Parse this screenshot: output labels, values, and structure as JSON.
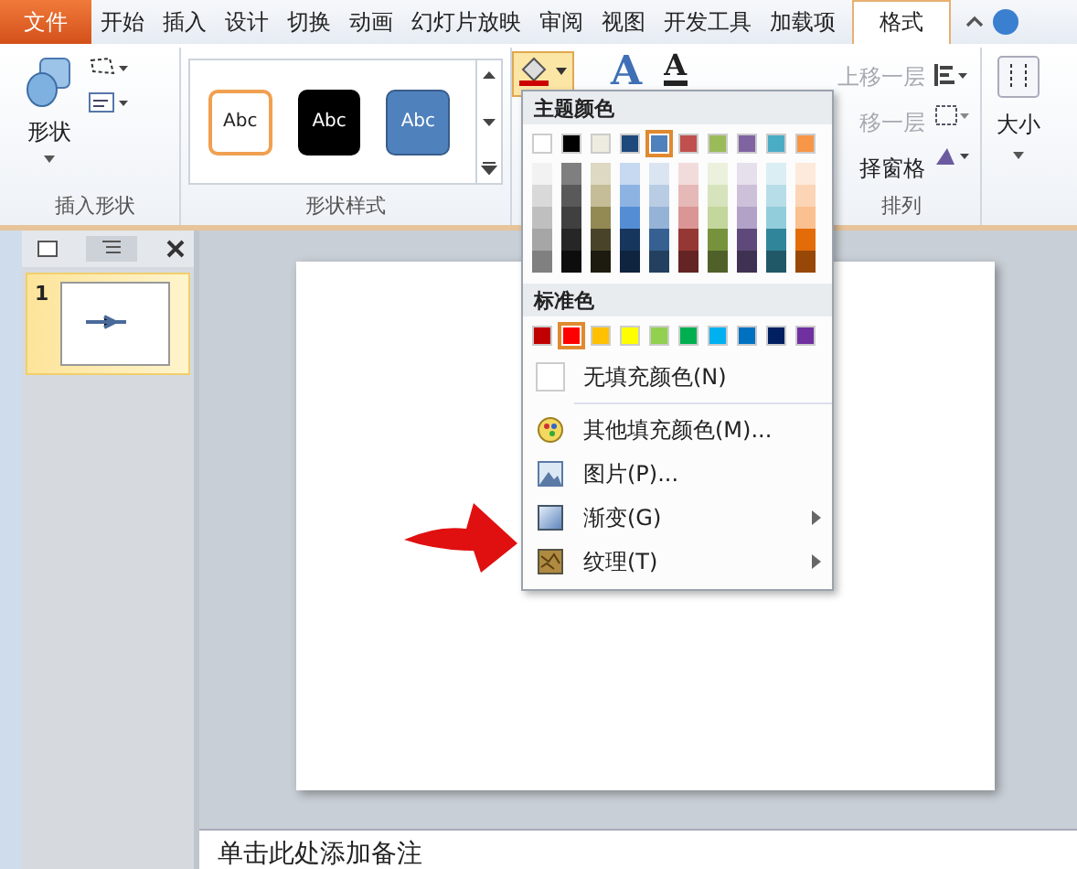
{
  "tabs": [
    {
      "label": "文件",
      "kind": "file",
      "selected": false
    },
    {
      "label": "开始",
      "kind": "tab",
      "selected": false
    },
    {
      "label": "插入",
      "kind": "tab",
      "selected": false
    },
    {
      "label": "设计",
      "kind": "tab",
      "selected": false
    },
    {
      "label": "切换",
      "kind": "tab",
      "selected": false
    },
    {
      "label": "动画",
      "kind": "tab",
      "selected": false
    },
    {
      "label": "幻灯片放映",
      "kind": "tab",
      "selected": false
    },
    {
      "label": "审阅",
      "kind": "tab",
      "selected": false
    },
    {
      "label": "视图",
      "kind": "tab",
      "selected": false
    },
    {
      "label": "开发工具",
      "kind": "tab",
      "selected": false
    },
    {
      "label": "加载项",
      "kind": "tab",
      "selected": false
    },
    {
      "label": "格式",
      "kind": "tab",
      "selected": true
    }
  ],
  "ribbon": {
    "insert_shapes": {
      "shapes_button": "形状",
      "group_label": "插入形状"
    },
    "shape_styles": {
      "styles": [
        {
          "label": "Abc",
          "kind": "outline"
        },
        {
          "label": "Abc",
          "kind": "black"
        },
        {
          "label": "Abc",
          "kind": "blue"
        }
      ],
      "group_label": "形状样式"
    },
    "wordart": {
      "quick_styles": "A",
      "text_fill": "A"
    },
    "arrange": {
      "items": [
        {
          "label": "上移一层",
          "disabled": true
        },
        {
          "label": "移一层",
          "disabled": true
        },
        {
          "label": "择窗格",
          "disabled": false
        }
      ],
      "group_label": "排列"
    },
    "size": {
      "button": "大小"
    }
  },
  "fill_menu": {
    "theme_header": "主题颜色",
    "theme_colors": [
      {
        "color": "#ffffff",
        "selected": false,
        "shades": [
          {
            "color": "#f2f2f2"
          },
          {
            "color": "#d9d9d9"
          },
          {
            "color": "#bfbfbf"
          },
          {
            "color": "#a6a6a6"
          },
          {
            "color": "#808080"
          }
        ]
      },
      {
        "color": "#000000",
        "selected": false,
        "shades": [
          {
            "color": "#7f7f7f"
          },
          {
            "color": "#595959"
          },
          {
            "color": "#404040"
          },
          {
            "color": "#262626"
          },
          {
            "color": "#0d0d0d"
          }
        ]
      },
      {
        "color": "#eeece1",
        "selected": false,
        "shades": [
          {
            "color": "#ddd9c3"
          },
          {
            "color": "#c4bd97"
          },
          {
            "color": "#938953"
          },
          {
            "color": "#494429"
          },
          {
            "color": "#1d1b10"
          }
        ]
      },
      {
        "color": "#1f497d",
        "selected": false,
        "shades": [
          {
            "color": "#c6d9f0"
          },
          {
            "color": "#8db3e2"
          },
          {
            "color": "#548dd4"
          },
          {
            "color": "#17365d"
          },
          {
            "color": "#0f243e"
          }
        ]
      },
      {
        "color": "#4f81bd",
        "selected": true,
        "shades": [
          {
            "color": "#dbe5f1"
          },
          {
            "color": "#b8cce4"
          },
          {
            "color": "#95b3d7"
          },
          {
            "color": "#366092"
          },
          {
            "color": "#244061"
          }
        ]
      },
      {
        "color": "#c0504d",
        "selected": false,
        "shades": [
          {
            "color": "#f2dcdb"
          },
          {
            "color": "#e5b9b7"
          },
          {
            "color": "#d99694"
          },
          {
            "color": "#953734"
          },
          {
            "color": "#632423"
          }
        ]
      },
      {
        "color": "#9bbb59",
        "selected": false,
        "shades": [
          {
            "color": "#ebf1dd"
          },
          {
            "color": "#d7e3bc"
          },
          {
            "color": "#c3d69b"
          },
          {
            "color": "#76923c"
          },
          {
            "color": "#4f6128"
          }
        ]
      },
      {
        "color": "#8064a2",
        "selected": false,
        "shades": [
          {
            "color": "#e5e0ec"
          },
          {
            "color": "#ccc1d9"
          },
          {
            "color": "#b2a2c7"
          },
          {
            "color": "#5f497a"
          },
          {
            "color": "#3f3151"
          }
        ]
      },
      {
        "color": "#4bacc6",
        "selected": false,
        "shades": [
          {
            "color": "#dbeef3"
          },
          {
            "color": "#b7dde8"
          },
          {
            "color": "#92cddc"
          },
          {
            "color": "#31859b"
          },
          {
            "color": "#205867"
          }
        ]
      },
      {
        "color": "#f79646",
        "selected": false,
        "shades": [
          {
            "color": "#fdeada"
          },
          {
            "color": "#fbd5b5"
          },
          {
            "color": "#fac08f"
          },
          {
            "color": "#e36c09"
          },
          {
            "color": "#974806"
          }
        ]
      }
    ],
    "standard_header": "标准色",
    "standard_colors": [
      {
        "color": "#c00000",
        "selected": false
      },
      {
        "color": "#ff0000",
        "selected": true
      },
      {
        "color": "#ffc000",
        "selected": false
      },
      {
        "color": "#ffff00",
        "selected": false
      },
      {
        "color": "#92d050",
        "selected": false
      },
      {
        "color": "#00b050",
        "selected": false
      },
      {
        "color": "#00b0f0",
        "selected": false
      },
      {
        "color": "#0070c0",
        "selected": false
      },
      {
        "color": "#002060",
        "selected": false
      },
      {
        "color": "#7030a0",
        "selected": false
      }
    ],
    "items": [
      {
        "label": "无填充颜色(N)",
        "kind": "none",
        "submenu": false
      },
      {
        "label": "其他填充颜色(M)...",
        "kind": "palette",
        "submenu": false
      },
      {
        "label": "图片(P)...",
        "kind": "picture",
        "submenu": false
      },
      {
        "label": "渐变(G)",
        "kind": "gradient",
        "submenu": true
      },
      {
        "label": "纹理(T)",
        "kind": "texture",
        "submenu": true
      }
    ]
  },
  "slides_panel": {
    "slides": [
      {
        "number": "1",
        "selected": true
      }
    ]
  },
  "notes": {
    "placeholder": "单击此处添加备注"
  }
}
